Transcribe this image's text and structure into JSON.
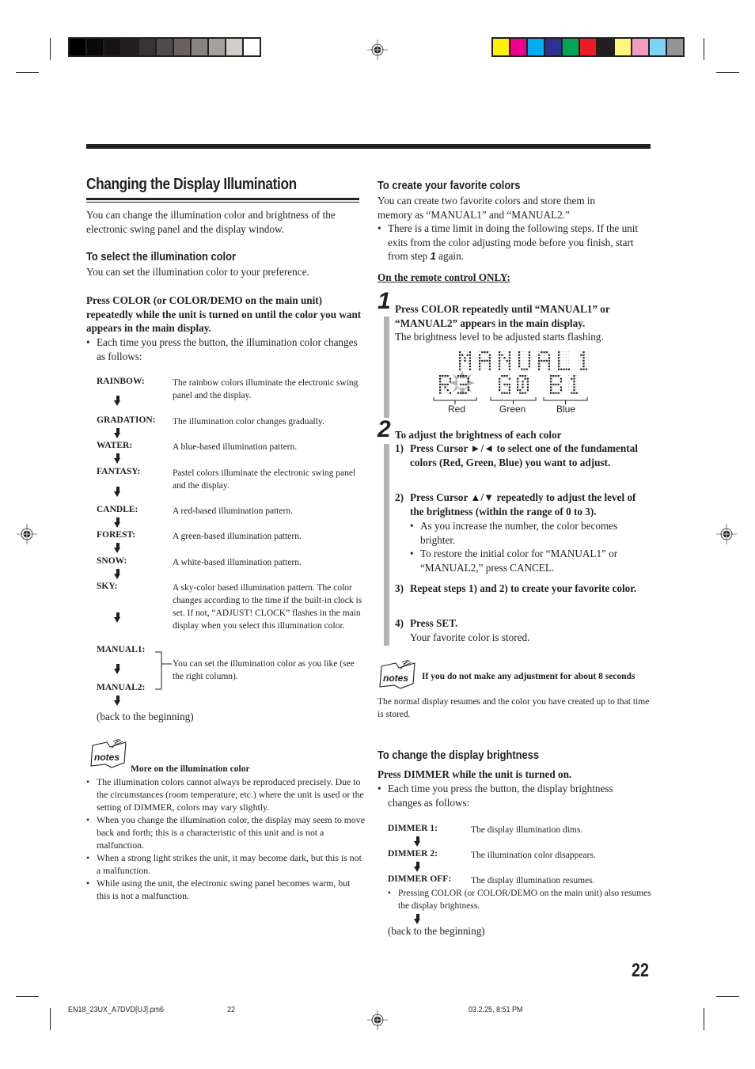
{
  "print_marks": {
    "gray_swatches": [
      "#000000",
      "#0b0a09",
      "#171413",
      "#231f1d",
      "#3a3230",
      "#52494a",
      "#6b605e",
      "#8a807e",
      "#a89f9d",
      "#d4cccb",
      "#ffffff"
    ],
    "color_swatches": [
      "#fff200",
      "#ec008c",
      "#00aeef",
      "#2e3192",
      "#00a651",
      "#ed1c24",
      "#231f20",
      "#fff57d",
      "#f49ac2",
      "#7fd4f6",
      "#939598"
    ]
  },
  "left": {
    "title": "Changing the Display Illumination",
    "intro": "You can change the illumination color and brightness of the electronic swing panel and the display window.",
    "select_heading": "To select the illumination color",
    "select_text": "You can set the illumination color to your preference.",
    "instruction": "Press COLOR (or COLOR/DEMO on the main unit) repeatedly while the unit is turned on until the color you want appears in the main display.",
    "bullet": "Each time you press the button, the illumination color changes as follows:",
    "cycle": [
      {
        "label": "RAINBOW:",
        "desc": "The rainbow colors illuminate the electronic swing panel and the display."
      },
      {
        "label": "GRADATION:",
        "desc": "The illumination color changes gradually."
      },
      {
        "label": "WATER:",
        "desc": "A blue-based illumination pattern."
      },
      {
        "label": "FANTASY:",
        "desc": "Pastel colors illuminate the electronic swing panel and the display."
      },
      {
        "label": "CANDLE:",
        "desc": "A red-based illumination pattern."
      },
      {
        "label": "FOREST:",
        "desc": "A green-based illumination pattern."
      },
      {
        "label": "SNOW:",
        "desc": "A white-based illumination pattern."
      },
      {
        "label": "SKY:",
        "desc": "A sky-color based illumination pattern. The color changes according to the time if the built-in clock is set. If not, “ADJUST! CLOCK” flashes in the main display when you select this illumination color."
      },
      {
        "label": "MANUAL1:",
        "desc": ""
      },
      {
        "label": "MANUAL2:",
        "desc": ""
      }
    ],
    "manual_desc": "You can set the illumination color as you like (see the right column).",
    "back": "(back to the beginning)",
    "notes_label": "notes",
    "notes_heading": "More on the illumination color",
    "notes": [
      "The illumination colors cannot always be reproduced precisely. Due to the circumstances (room temperature, etc.) where the unit is used or the setting of DIMMER, colors may vary slightly.",
      "When you change the illumination color, the display may seem to move back and forth; this is a characteristic of this unit and is not a malfunction.",
      "When a strong light strikes the unit, it may become dark, but this is not a malfunction.",
      "While using the unit, the electronic swing panel becomes warm, but this is not a malfunction."
    ]
  },
  "right": {
    "create_heading": "To create your favorite colors",
    "create_text": "You can create two favorite colors and store them in memory as “MANUAL1” and “MANUAL2.”",
    "create_bullet_a": "There is a time limit in doing the following steps. If the unit exits from the color adjusting mode before you finish, start from step ",
    "create_bullet_step": "1",
    "create_bullet_b": " again.",
    "remote_only": "On the remote control ONLY:",
    "step1": {
      "num": "1",
      "bold": "Press COLOR repeatedly until “MANUAL1” or “MANUAL2” appears in the main display.",
      "text": "The brightness level to be adjusted starts flashing.",
      "display": {
        "line1": "MANUAL1",
        "red": "R3",
        "green": "G0",
        "blue": "B1",
        "labels": [
          "Red",
          "Green",
          "Blue"
        ]
      }
    },
    "step2": {
      "num": "2",
      "heading": "To adjust the brightness of each color",
      "items": [
        {
          "n": "1)",
          "text": "Press Cursor ►/◄ to select one of the fundamental colors (Red, Green, Blue) you want to adjust."
        },
        {
          "n": "2)",
          "text": "Press Cursor ▲/▼ repeatedly to adjust the level of the brightness (within the range of 0 to 3)."
        },
        {
          "n": "3)",
          "text": "Repeat steps 1) and 2) to create your favorite color."
        },
        {
          "n": "4)",
          "text": "Press SET."
        }
      ],
      "sub_bullets": [
        "As you increase the number, the color becomes brighter.",
        "To restore the initial color for “MANUAL1” or “MANUAL2,” press CANCEL."
      ],
      "set_result": "Your favorite color is stored."
    },
    "notes_label": "notes",
    "notes_heading": "If you do not make any adjustment for about 8 seconds",
    "notes_text": "The normal display resumes and the color you have created up to that time is stored.",
    "dimmer_heading": "To change the display brightness",
    "dimmer_instruction": "Press DIMMER while the unit is turned on.",
    "dimmer_bullet": "Each time you press the button, the display brightness changes as follows:",
    "dimmer_cycle": [
      {
        "label": "DIMMER 1:",
        "desc": "The display illumination dims."
      },
      {
        "label": "DIMMER 2:",
        "desc": "The illumination color disappears."
      },
      {
        "label": "DIMMER OFF:",
        "desc": "The display illumination resumes."
      }
    ],
    "dimmer_note": "Pressing COLOR (or COLOR/DEMO on the main unit) also resumes the display brightness.",
    "back": "(back to the beginning)"
  },
  "page_number": "22",
  "footer": {
    "file": "EN18_23UX_A7DVD[UJ].pm6",
    "page": "22",
    "date": "03.2.25, 8:51 PM"
  }
}
